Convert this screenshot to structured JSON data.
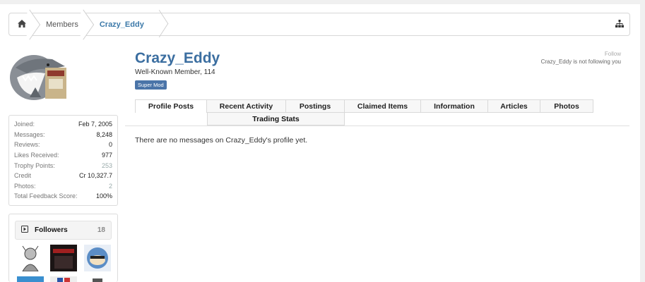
{
  "breadcrumb": {
    "home_icon": "home-icon",
    "members": "Members",
    "current": "Crazy_Eddy",
    "sitemap_icon": "sitemap-icon"
  },
  "profile": {
    "username": "Crazy_Eddy",
    "user_title": "Well-Known Member, 114",
    "badge": "Super Mod",
    "follow_label": "Follow",
    "follow_status": "Crazy_Eddy is not following you"
  },
  "stats": [
    {
      "label": "Joined:",
      "value": "Feb 7, 2005"
    },
    {
      "label": "Messages:",
      "value": "8,248"
    },
    {
      "label": "Reviews:",
      "value": "0"
    },
    {
      "label": "Likes Received:",
      "value": "977"
    },
    {
      "label": "Trophy Points:",
      "value": "253"
    },
    {
      "label": "Credit",
      "value": "Cr 10,327.7"
    },
    {
      "label": "Photos:",
      "value": "2"
    },
    {
      "label": "Total Feedback Score:",
      "value": "100%"
    }
  ],
  "followers": {
    "title": "Followers",
    "count": "18",
    "icon": "play-square-icon"
  },
  "tabs": [
    "Profile Posts",
    "Recent Activity",
    "Postings",
    "Claimed Items",
    "Information",
    "Articles",
    "Photos"
  ],
  "tab_row2": "Trading Stats",
  "empty_message": "There are no messages on Crazy_Eddy's profile yet.",
  "colors": {
    "accent": "#3b6ea0",
    "badge": "#4a74a8",
    "link": "#3c79a9"
  }
}
